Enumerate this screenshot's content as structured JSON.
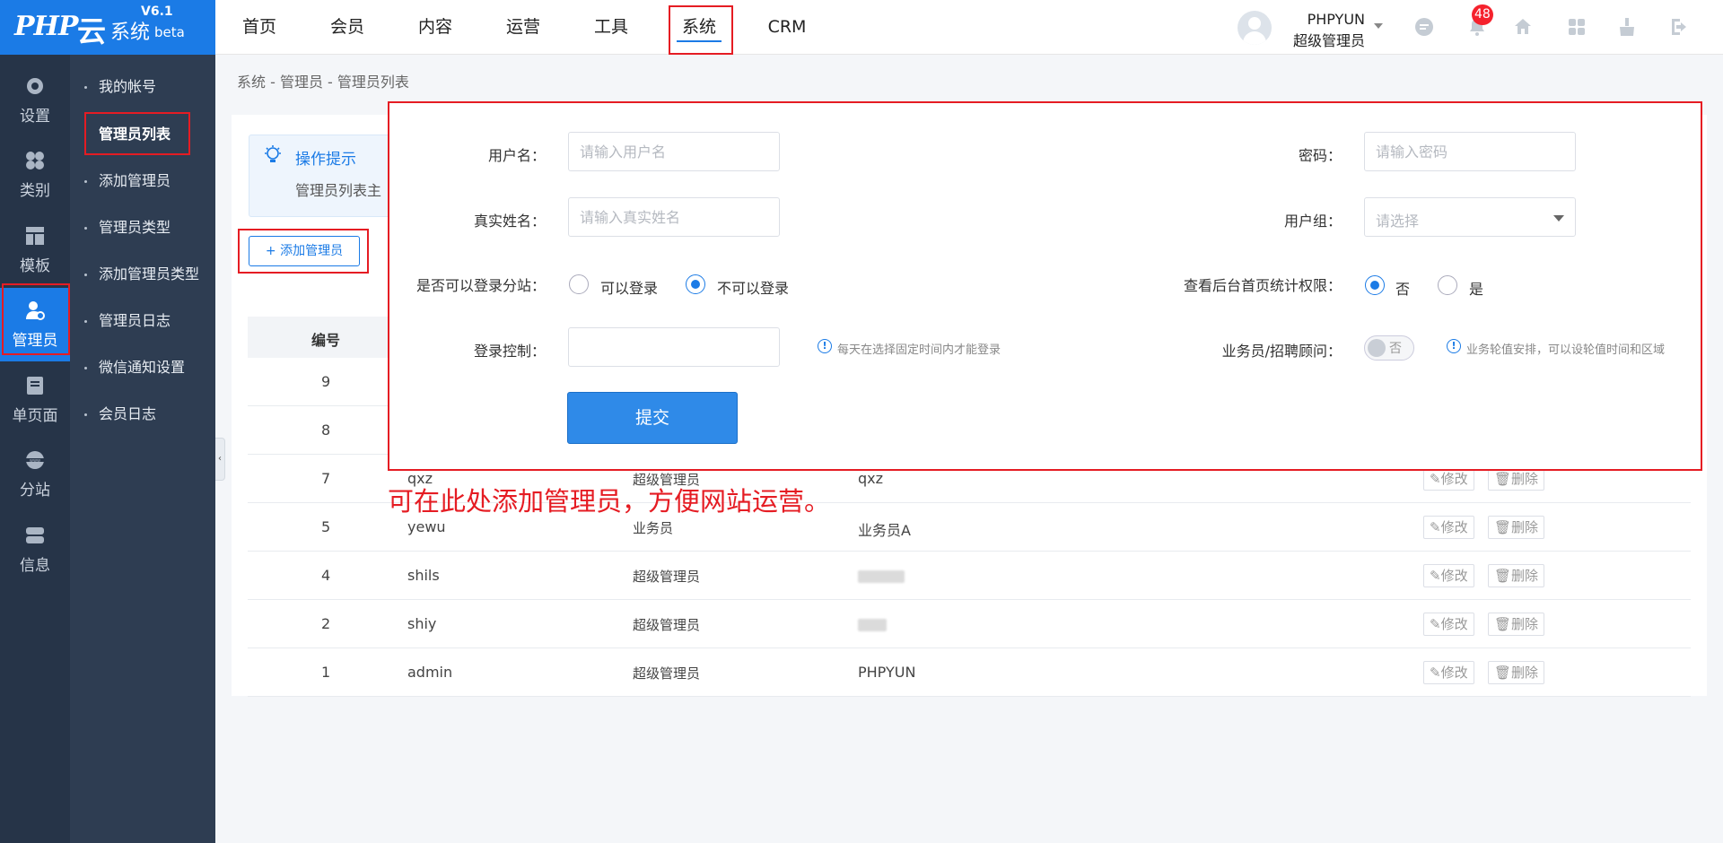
{
  "logo": {
    "brand": "PHP",
    "yun": "云",
    "system": "系统",
    "version": "V6.1",
    "tag": "beta"
  },
  "topnav": [
    {
      "label": "首页"
    },
    {
      "label": "会员"
    },
    {
      "label": "内容"
    },
    {
      "label": "运营"
    },
    {
      "label": "工具"
    },
    {
      "label": "系统"
    },
    {
      "label": "CRM"
    }
  ],
  "user": {
    "name": "PHPYUN",
    "role": "超级管理员",
    "notifications": "48"
  },
  "leftbar": [
    {
      "label": "设置"
    },
    {
      "label": "类别"
    },
    {
      "label": "模板"
    },
    {
      "label": "管理员"
    },
    {
      "label": "单页面"
    },
    {
      "label": "分站"
    },
    {
      "label": "信息"
    }
  ],
  "subnav": [
    {
      "label": "我的帐号"
    },
    {
      "label": "管理员列表"
    },
    {
      "label": "添加管理员"
    },
    {
      "label": "管理员类型"
    },
    {
      "label": "添加管理员类型"
    },
    {
      "label": "管理员日志"
    },
    {
      "label": "微信通知设置"
    },
    {
      "label": "会员日志"
    }
  ],
  "breadcrumb": "系统 - 管理员 - 管理员列表",
  "tip": {
    "title": "操作提示",
    "text": "管理员列表主"
  },
  "add_button": "+ 添加管理员",
  "table": {
    "header_id": "编号",
    "rows": [
      {
        "id": "9",
        "username": "",
        "group": "",
        "realname": ""
      },
      {
        "id": "8",
        "username": "",
        "group": "",
        "realname": ""
      },
      {
        "id": "7",
        "username": "qxz",
        "group": "超级管理员",
        "realname": "qxz"
      },
      {
        "id": "5",
        "username": "yewu",
        "group": "业务员",
        "realname": "业务员A"
      },
      {
        "id": "4",
        "username": "shils",
        "group": "超级管理员",
        "realname": ""
      },
      {
        "id": "2",
        "username": "shiy",
        "group": "超级管理员",
        "realname": ""
      },
      {
        "id": "1",
        "username": "admin",
        "group": "超级管理员",
        "realname": "PHPYUN"
      }
    ],
    "edit_label": "修改",
    "delete_label": "删除"
  },
  "form": {
    "username_label": "用户名：",
    "username_placeholder": "请输入用户名",
    "password_label": "密码：",
    "password_placeholder": "请输入密码",
    "realname_label": "真实姓名：",
    "realname_placeholder": "请输入真实姓名",
    "group_label": "用户组：",
    "group_placeholder": "请选择",
    "substation_label": "是否可以登录分站：",
    "substation_yes": "可以登录",
    "substation_no": "不可以登录",
    "stats_label": "查看后台首页统计权限：",
    "stats_no": "否",
    "stats_yes": "是",
    "login_control_label": "登录控制：",
    "login_control_hint": "每天在选择固定时间内才能登录",
    "sales_label": "业务员/招聘顾问：",
    "sales_toggle": "否",
    "sales_hint": "业务轮值安排，可以设轮值时间和区域",
    "submit": "提交"
  },
  "annotation": "可在此处添加管理员，方便网站运营。",
  "colors": {
    "brand": "#1b7be6",
    "highlight": "#e51c23",
    "sidebar": "#263448",
    "subsidebar": "#2e3d52"
  }
}
